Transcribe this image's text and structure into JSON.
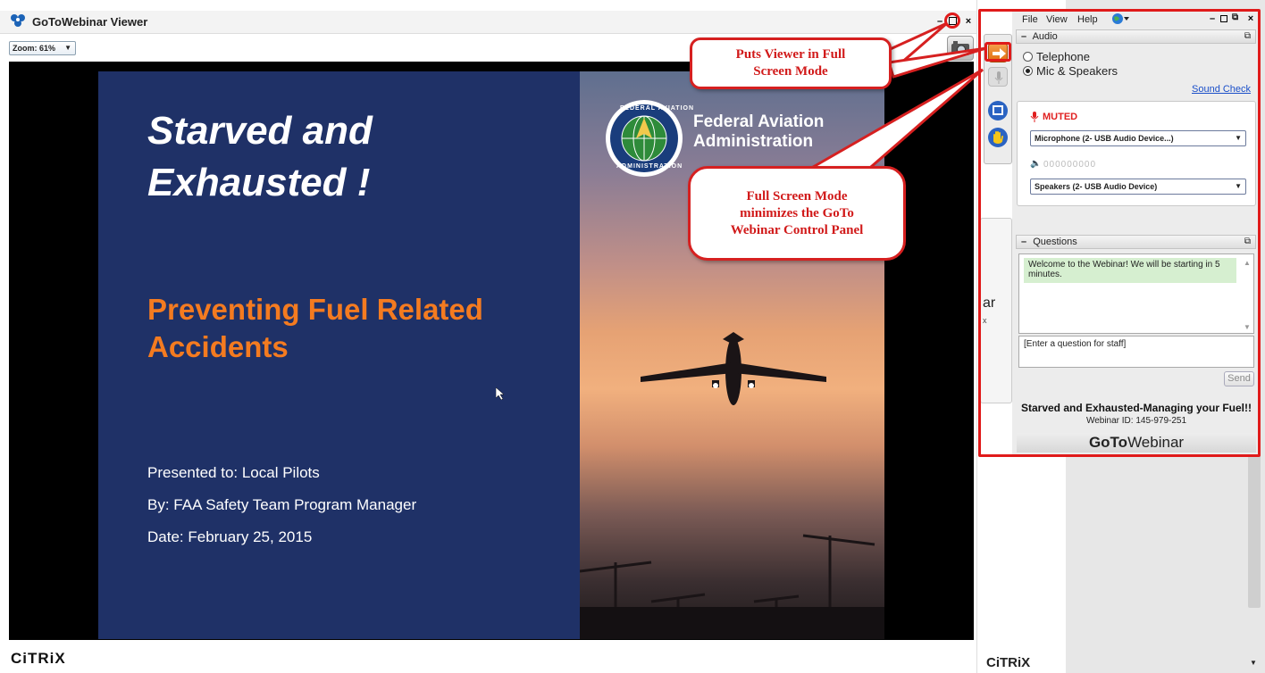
{
  "viewer": {
    "title": "GoToWebinar Viewer",
    "zoom_label": "Zoom: 61%",
    "window_buttons": [
      "–",
      "□",
      "×"
    ],
    "brand": "CiTRiX"
  },
  "slide": {
    "title": "Starved and\nExhausted !",
    "subtitle": "Preventing Fuel Related\nAccidents",
    "presented_to": "Presented to: Local Pilots",
    "by": "By: FAA Safety Team Program Manager",
    "date": "Date: February 25, 2015",
    "agency": "Federal Aviation\nAdministration",
    "seal_top": "FEDERAL AVIATION",
    "seal_bottom": "ADMINISTRATION"
  },
  "callouts": {
    "full_screen_tip": "Puts Viewer in Full\nScreen Mode",
    "minimize_tip": "Full Screen Mode\nminimizes the GoTo\nWebinar Control Panel"
  },
  "mid_strip": {
    "partial_text": "ar",
    "partial_x": "x",
    "brand": "CiTRiX"
  },
  "control_panel": {
    "menu": [
      "File",
      "View",
      "Help"
    ],
    "audio": {
      "header": "Audio",
      "options": [
        {
          "label": "Telephone",
          "selected": false
        },
        {
          "label": "Mic & Speakers",
          "selected": true
        }
      ],
      "sound_check": "Sound Check",
      "muted_label": "MUTED",
      "microphone": "Microphone (2- USB Audio Device...)",
      "level": "000000000",
      "speakers": "Speakers (2- USB Audio Device)"
    },
    "questions": {
      "header": "Questions",
      "message": "Welcome to the Webinar!  We will be starting in 5 minutes.",
      "input_placeholder": "[Enter a question for staff]",
      "send_label": "Send"
    },
    "webinar_title": "Starved and Exhausted-Managing your Fuel!!",
    "webinar_id": "Webinar ID: 145-979-251",
    "logo_bold": "GoTo",
    "logo_light": "Webinar"
  },
  "colors": {
    "slide_bg": "#1f3167",
    "subtitle": "#f47b20",
    "callout_red": "#d62020",
    "muted_red": "#e02020"
  }
}
